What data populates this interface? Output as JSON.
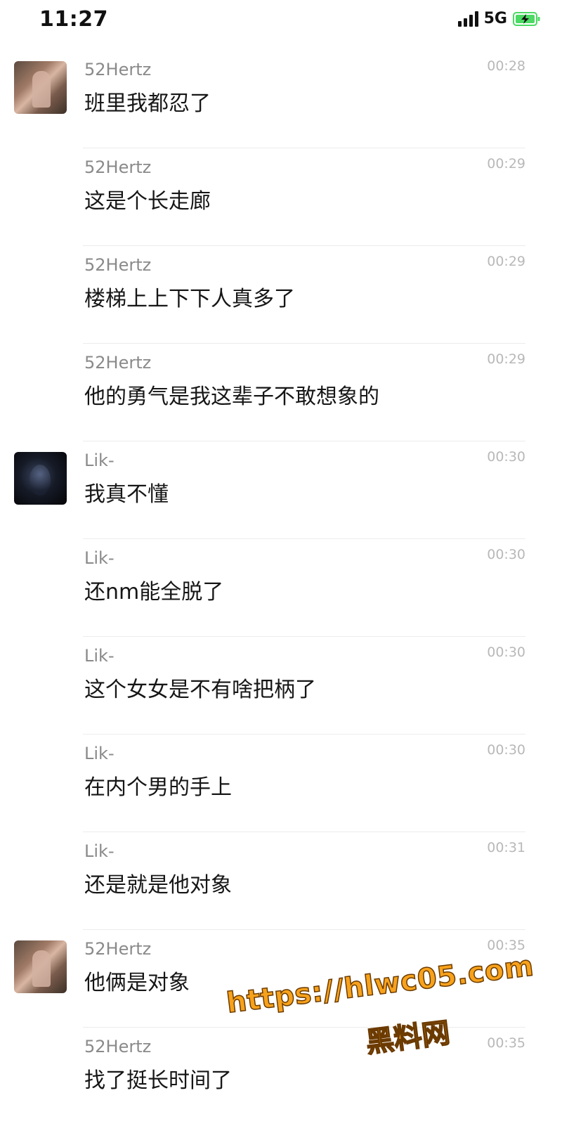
{
  "status_bar": {
    "time": "11:27",
    "network": "5G",
    "signal_icon": "cellular-signal-icon",
    "battery_icon": "battery-charging-icon",
    "battery_color": "#4cd964"
  },
  "messages": [
    {
      "sender": "52Hertz",
      "time": "00:28",
      "text": "班里我都忍了",
      "avatar": "52hertz-avatar"
    },
    {
      "sender": "52Hertz",
      "time": "00:29",
      "text": "这是个长走廊",
      "avatar": ""
    },
    {
      "sender": "52Hertz",
      "time": "00:29",
      "text": "楼梯上上下下人真多了",
      "avatar": ""
    },
    {
      "sender": "52Hertz",
      "time": "00:29",
      "text": "他的勇气是我这辈子不敢想象的",
      "avatar": ""
    },
    {
      "sender": "Lik-",
      "time": "00:30",
      "text": "我真不懂",
      "avatar": "lik-avatar"
    },
    {
      "sender": "Lik-",
      "time": "00:30",
      "text": "还nm能全脱了",
      "avatar": ""
    },
    {
      "sender": "Lik-",
      "time": "00:30",
      "text": "这个女女是不有啥把柄了",
      "avatar": ""
    },
    {
      "sender": "Lik-",
      "time": "00:30",
      "text": "在内个男的手上",
      "avatar": ""
    },
    {
      "sender": "Lik-",
      "time": "00:31",
      "text": "还是就是他对象",
      "avatar": ""
    },
    {
      "sender": "52Hertz",
      "time": "00:35",
      "text": "他俩是对象",
      "avatar": "52hertz-avatar"
    },
    {
      "sender": "52Hertz",
      "time": "00:35",
      "text": "找了挺长时间了",
      "avatar": ""
    }
  ],
  "watermark": {
    "url": "https://hlwc05.com",
    "name": "黑料网",
    "color": "#f7a21c"
  }
}
